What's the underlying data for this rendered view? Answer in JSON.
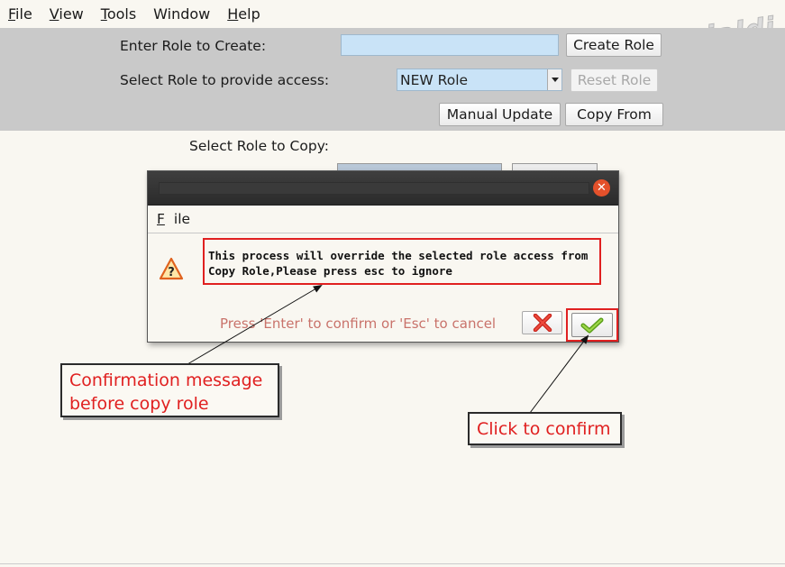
{
  "menubar": {
    "items": [
      {
        "mnemonic": "F",
        "rest": "ile"
      },
      {
        "mnemonic": "V",
        "rest": "iew"
      },
      {
        "mnemonic": "T",
        "rest": "ools"
      },
      {
        "mnemonic": "",
        "rest": "Window"
      },
      {
        "mnemonic": "H",
        "rest": "elp"
      }
    ]
  },
  "form": {
    "create_label": "Enter Role to Create:",
    "create_value": "",
    "create_button": "Create Role",
    "select_label": "Select Role to provide access:",
    "select_value": "NEW Role",
    "reset_button": "Reset Role",
    "manual_update_button": "Manual Update",
    "copy_from_button": "Copy  From",
    "copy_label": "Select Role to Copy:"
  },
  "dialog": {
    "menu": {
      "mnemonic": "F",
      "rest": "ile"
    },
    "message_line1": "This process will override the selected role access from",
    "message_line2": "Copy Role,Please press esc to ignore",
    "hint": "Press 'Enter' to confirm or 'Esc' to cancel",
    "close_icon": "close-icon",
    "warning_icon": "warning-question-icon",
    "cancel_icon": "red-x-icon",
    "confirm_icon": "green-check-icon"
  },
  "annotations": {
    "callout1_line1": "Confirmation message",
    "callout1_line2": "before copy role",
    "callout2": "Click to confirm"
  },
  "colors": {
    "panel_bg": "#c9c9c9",
    "input_bg": "#c9e3f7",
    "annotation_red": "#e02020",
    "hint_text": "#c9736b"
  }
}
